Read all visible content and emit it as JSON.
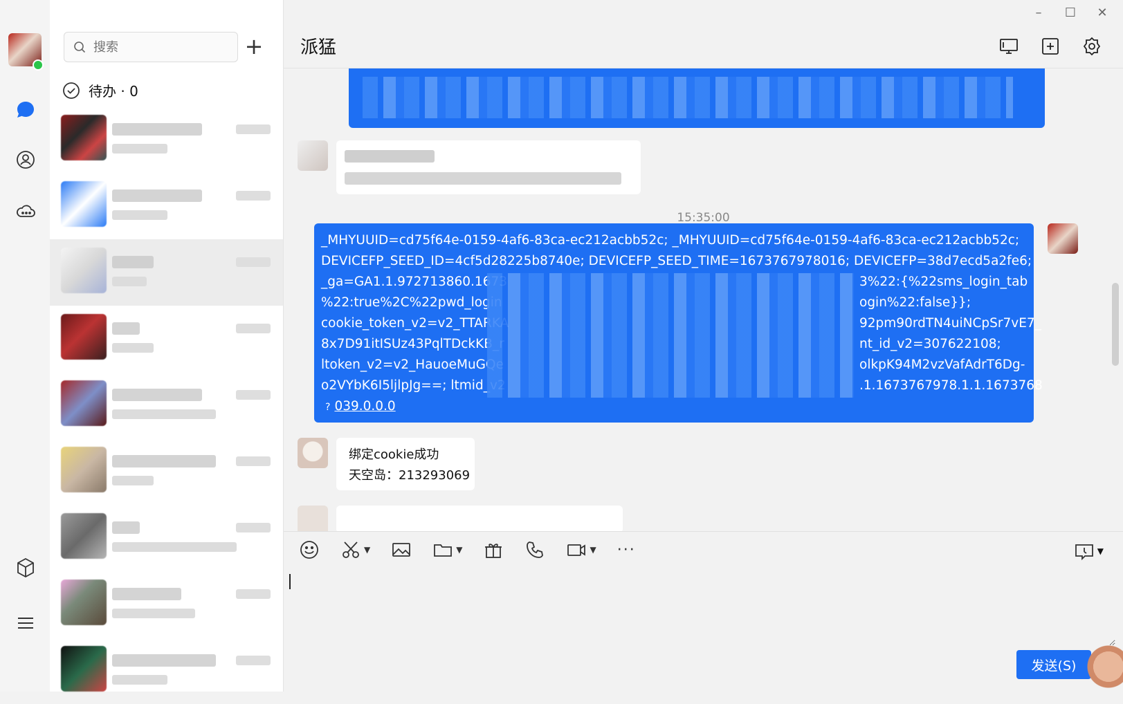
{
  "window": {
    "minimize": "–",
    "maximize": "☐",
    "close": "✕"
  },
  "search": {
    "placeholder": "搜索"
  },
  "todo": {
    "label": "待办 · 0"
  },
  "chat": {
    "title": "派猛",
    "timestamp": "15:35:00",
    "sent_message": {
      "lines": [
        "_MHYUUID=cd75f64e-0159-4af6-83ca-ec212acbb52c; _MHYUUID=cd75f64e-0159-4af6-83ca-ec212acbb52c;",
        "DEVICEFP_SEED_ID=4cf5d28225b8740e; DEVICEFP_SEED_TIME=1673767978016; DEVICEFP=38d7ecd5a2fe6;",
        "_ga=GA1.1.972713860.1673",
        "%22:true%2C%22pwd_login",
        "cookie_token_v2=v2_TTARKA",
        "8x7D91itISUz43PqlTDckKB_r",
        "ltoken_v2=v2_HauoeMuGQe",
        "o2VYbK6I5ljlpJg==; ltmid_v2"
      ],
      "right_fragments": [
        "3%22:{%22sms_login_tab",
        "ogin%22:false}};",
        "92pm90rdTN4uiNCpSr7vE7_",
        "nt_id_v2=307622108;",
        "olkpK94M2vzVafAdrT6Dg-",
        ".1.1673767978.1.1.1673768"
      ],
      "link": "039.0.0.0",
      "link_prefix": "?"
    },
    "reply": {
      "line1": "绑定cookie成功",
      "line2": "天空岛：213293069"
    }
  },
  "composer": {
    "send_label": "发送(S)"
  },
  "colors": {
    "accent": "#1e6ff3",
    "online": "#2bc54a"
  },
  "icons": [
    "chat-icon",
    "contacts-icon",
    "cloud-icon",
    "app-box-icon",
    "menu-icon",
    "screen-share-icon",
    "add-window-icon",
    "settings-icon",
    "emoji-icon",
    "scissors-icon",
    "image-icon",
    "folder-icon",
    "gift-icon",
    "phone-icon",
    "video-icon",
    "history-icon"
  ]
}
